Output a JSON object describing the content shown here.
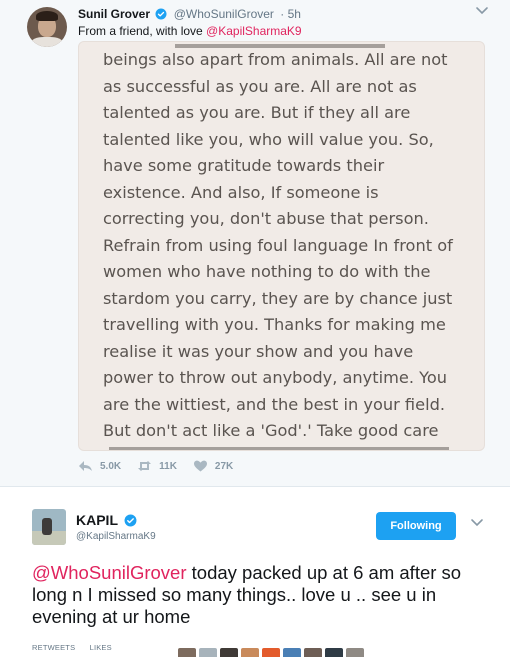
{
  "tweet1": {
    "author_name": "Sunil Grover",
    "author_handle": "@WhoSunilGrover",
    "time": "· 5h",
    "text_prefix": "From a friend, with love ",
    "mention": "@KapilSharmaK9",
    "photo_lines": [
      "beings also apart from animals. All are not",
      "as successful as you are. All are not as",
      "talented as you are. But if they all are",
      "talented like you, who will value you. So,",
      "have some gratitude towards their",
      "existence. And also, If someone is",
      "correcting you, don't abuse that person.",
      "Refrain from using foul language In front of",
      "women who have nothing to do with the",
      "stardom you carry, they are by chance just",
      "travelling with you. Thanks for making me",
      "realise it was your show and you have",
      "power to throw out anybody, anytime. You",
      "are the wittiest, and the best in your field.",
      "But don't act like a 'God'.' Take good care"
    ],
    "replies": "5.0K",
    "retweets": "11K",
    "likes": "27K"
  },
  "tweet2": {
    "author_name": "KAPIL",
    "author_handle": "@KapilSharmaK9",
    "follow_label": "Following",
    "mention": "@WhoSunilGrover",
    "text": " today packed up at 6 am after so long n I missed so many things.. love u .. see u in evening at ur home",
    "retweets_label": "RETWEETS",
    "likes_label": "LIKES"
  },
  "colors": {
    "accent": "#1da1f2",
    "mention": "#e0245e",
    "muted": "#657786",
    "card_bg": "#f5f8fa"
  },
  "icons": [
    "verified-icon",
    "chevron-down-icon",
    "reply-icon",
    "retweet-icon",
    "heart-icon"
  ]
}
